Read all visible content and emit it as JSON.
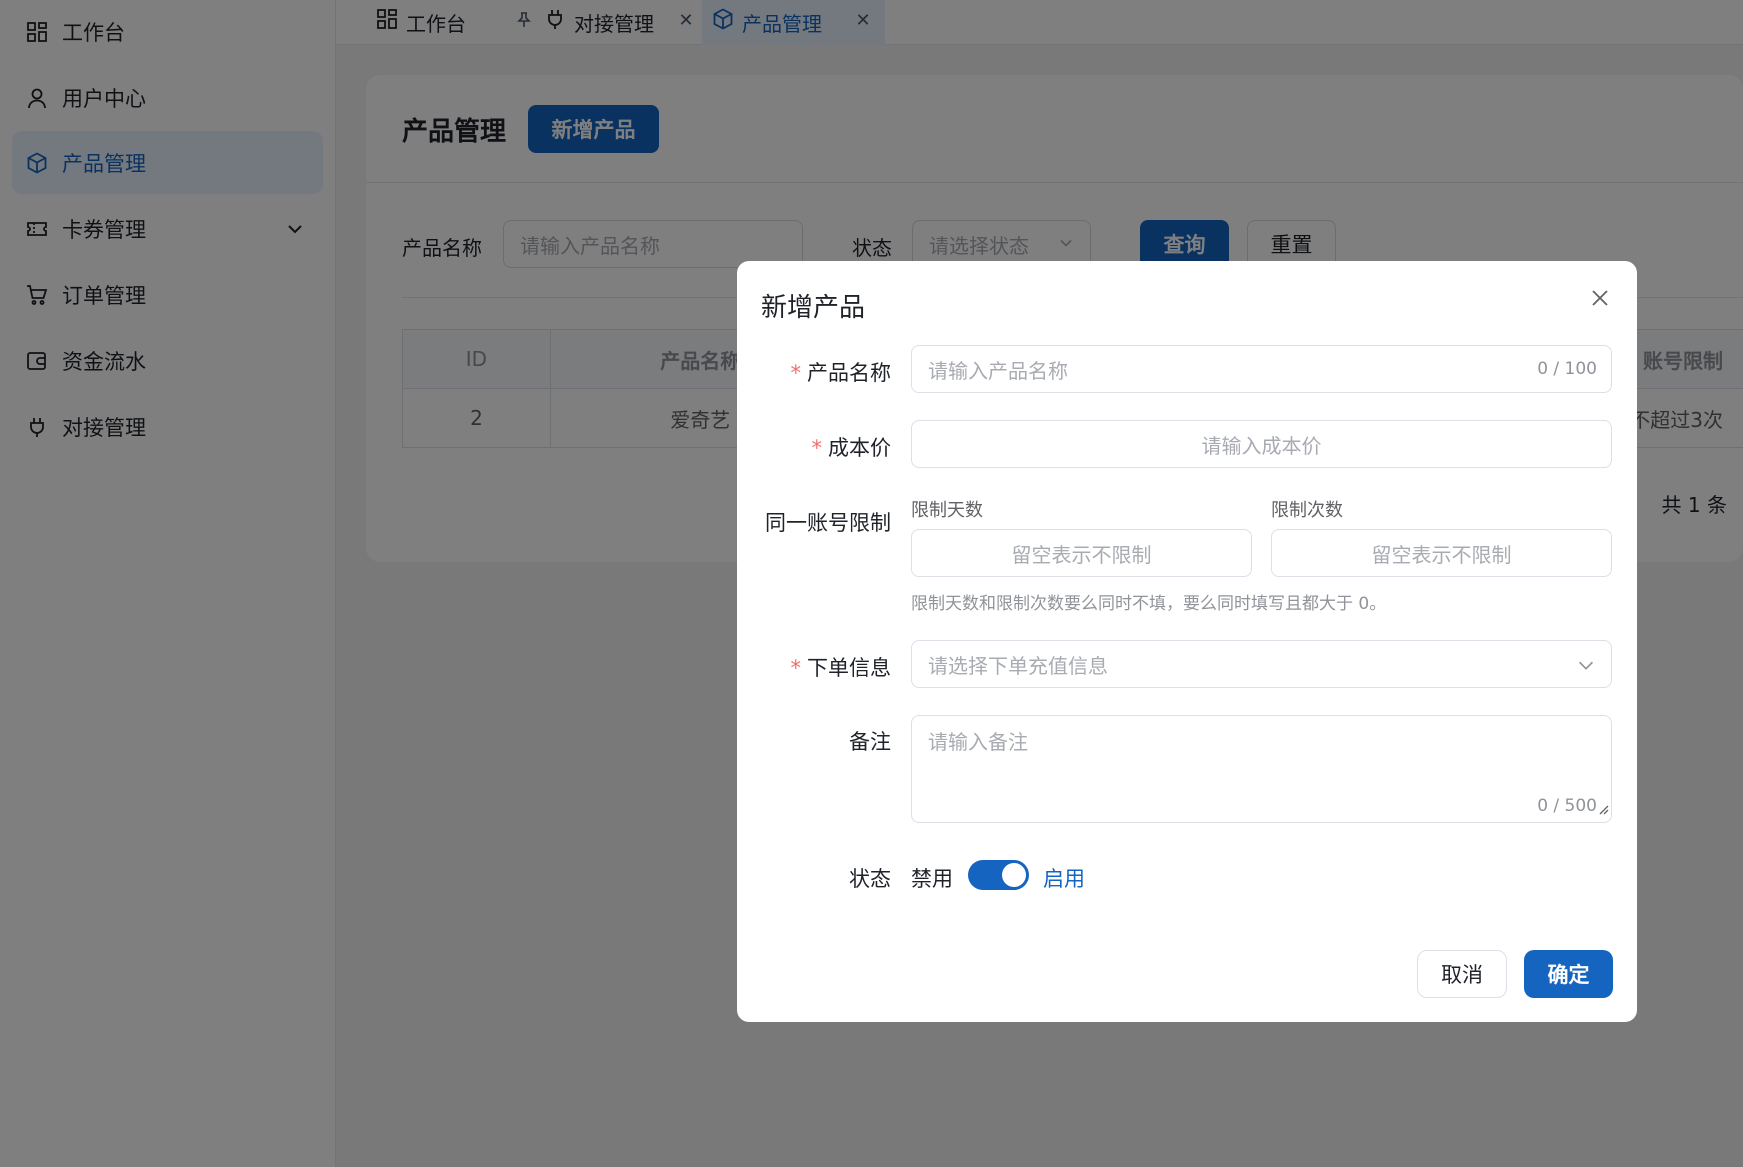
{
  "sidebar": {
    "items": [
      {
        "label": "工作台",
        "icon": "dashboard-icon"
      },
      {
        "label": "用户中心",
        "icon": "user-icon"
      },
      {
        "label": "产品管理",
        "icon": "box-icon"
      },
      {
        "label": "卡券管理",
        "icon": "ticket-icon"
      },
      {
        "label": "订单管理",
        "icon": "cart-icon"
      },
      {
        "label": "资金流水",
        "icon": "wallet-icon"
      },
      {
        "label": "对接管理",
        "icon": "plug-icon"
      }
    ]
  },
  "tabs": [
    {
      "label": "工作台",
      "icon": "dashboard-icon"
    },
    {
      "label": "对接管理",
      "icon": "plug-icon"
    },
    {
      "label": "产品管理",
      "icon": "box-icon"
    }
  ],
  "page": {
    "title": "产品管理",
    "add_button": "新增产品",
    "filter": {
      "name_label": "产品名称",
      "name_placeholder": "请输入产品名称",
      "status_label": "状态",
      "status_placeholder": "请选择状态",
      "query_button": "查询",
      "reset_button": "重置"
    },
    "table": {
      "headers": [
        "ID",
        "产品名称",
        "账号限制"
      ],
      "rows": [
        {
          "id": "2",
          "name": "爱奇艺",
          "limit": "不超过3次"
        }
      ]
    },
    "total": "共 1 条"
  },
  "modal": {
    "title": "新增产品",
    "fields": {
      "name": {
        "label": "产品名称",
        "placeholder": "请输入产品名称",
        "counter": "0 / 100"
      },
      "cost": {
        "label": "成本价",
        "placeholder": "请输入成本价"
      },
      "limit": {
        "label": "同一账号限制",
        "days_label": "限制天数",
        "days_placeholder": "留空表示不限制",
        "times_label": "限制次数",
        "times_placeholder": "留空表示不限制",
        "hint": "限制天数和限制次数要么同时不填，要么同时填写且都大于 0。"
      },
      "order_info": {
        "label": "下单信息",
        "placeholder": "请选择下单充值信息"
      },
      "remark": {
        "label": "备注",
        "placeholder": "请输入备注",
        "counter": "0 / 500"
      },
      "status": {
        "label": "状态",
        "off_text": "禁用",
        "on_text": "启用",
        "enabled": true
      }
    },
    "cancel_button": "取消",
    "confirm_button": "确定"
  },
  "colors": {
    "primary": "#1565c0",
    "required": "#f56c6c"
  }
}
